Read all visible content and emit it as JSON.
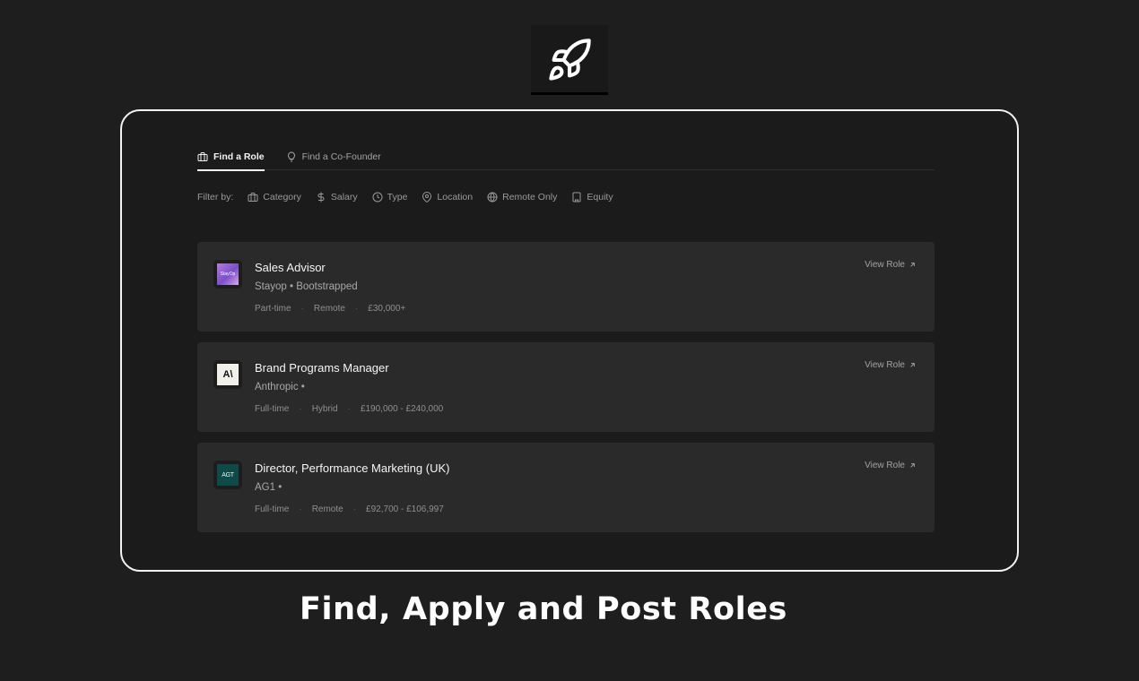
{
  "logo_icon": "rocket-icon",
  "tabs": [
    {
      "label": "Find a Role",
      "icon": "briefcase-icon",
      "active": true
    },
    {
      "label": "Find a Co-Founder",
      "icon": "lightbulb-icon",
      "active": false
    }
  ],
  "filters": {
    "label": "Filter by:",
    "items": [
      {
        "label": "Category",
        "icon": "briefcase-icon"
      },
      {
        "label": "Salary",
        "icon": "dollar-icon"
      },
      {
        "label": "Type",
        "icon": "clock-icon"
      },
      {
        "label": "Location",
        "icon": "map-pin-icon"
      },
      {
        "label": "Remote Only",
        "icon": "globe-icon"
      },
      {
        "label": "Equity",
        "icon": "building-icon"
      }
    ]
  },
  "jobs": [
    {
      "title": "Sales Advisor",
      "company": "Stayop • Bootstrapped",
      "logo_text": "StayOp",
      "type": "Part-time",
      "location": "Remote",
      "salary": "£30,000+",
      "view_label": "View Role"
    },
    {
      "title": "Brand Programs Manager",
      "company": "Anthropic •",
      "logo_text": "A\\",
      "type": "Full-time",
      "location": "Hybrid",
      "salary": "£190,000 - £240,000",
      "view_label": "View Role"
    },
    {
      "title": "Director, Performance Marketing (UK)",
      "company": "AG1 •",
      "logo_text": "AGT",
      "type": "Full-time",
      "location": "Remote",
      "salary": "£92,700 - £106,997",
      "view_label": "View Role"
    }
  ],
  "meta_separator": "·",
  "caption": "Find, Apply and Post Roles"
}
